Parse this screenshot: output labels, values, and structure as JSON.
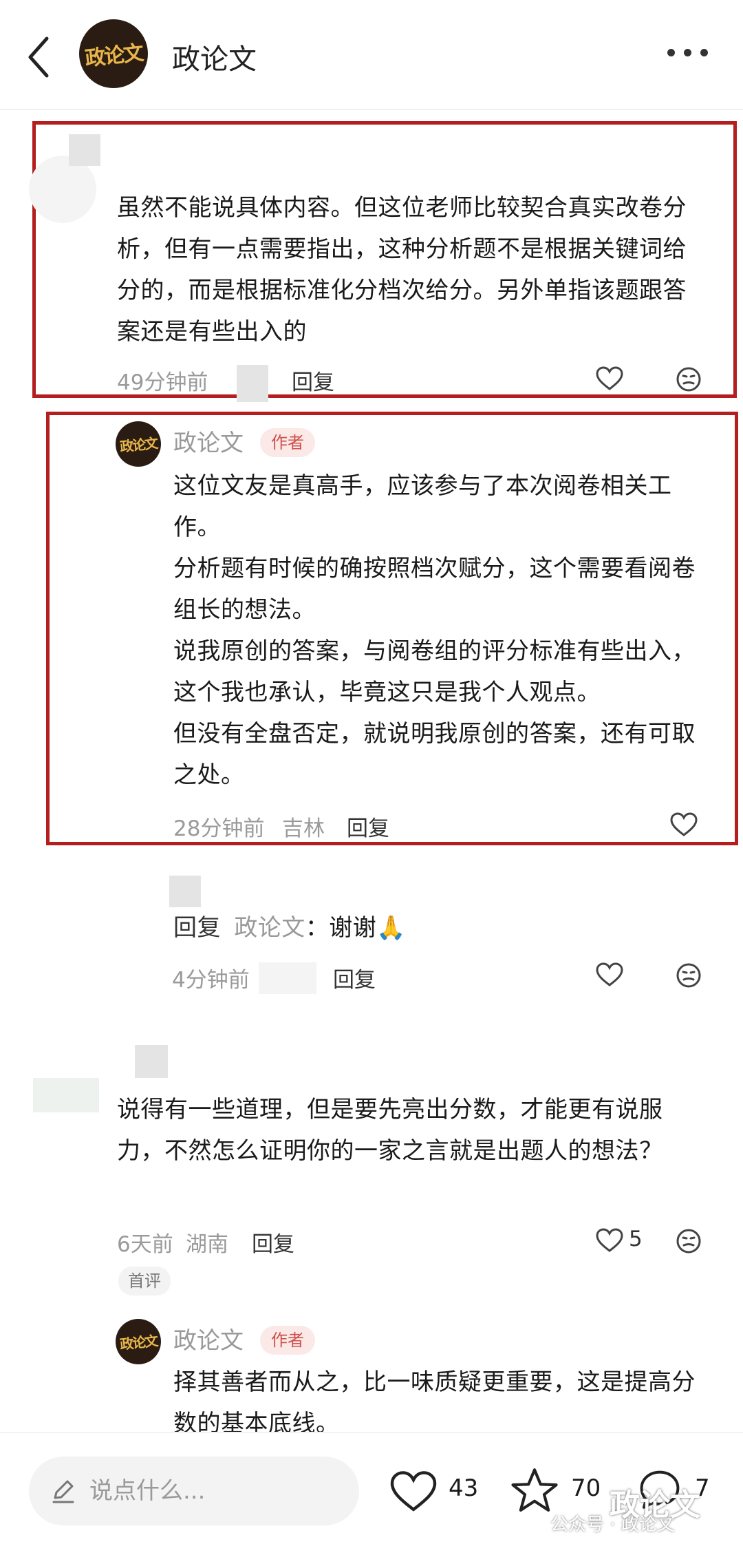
{
  "header": {
    "title": "政论文",
    "logo_text": "政论文"
  },
  "comments": [
    {
      "text": "虽然不能说具体内容。但这位老师比较契合真实改卷分析，但有一点需要指出，这种分析题不是根据关键词给分的，而是根据标准化分档次给分。另外单指该题跟答案还是有些出入的",
      "time": "49分钟前",
      "reply_label": "回复",
      "highlighted": true
    },
    {
      "author": "政论文",
      "badge": "作者",
      "lines": [
        "这位文友是真高手，应该参与了本次阅卷相关工作。",
        "分析题有时候的确按照档次赋分，这个需要看阅卷组长的想法。",
        "说我原创的答案，与阅卷组的评分标准有些出入，这个我也承认，毕竟这只是我个人观点。",
        "但没有全盘否定，就说明我原创的答案，还有可取之处。"
      ],
      "time": "28分钟前",
      "location": "吉林",
      "reply_label": "回复",
      "highlighted": true
    },
    {
      "reply_prefix": "回复",
      "reply_to": "政论文",
      "text": "：谢谢🙏",
      "time": "4分钟前",
      "reply_label": "回复"
    },
    {
      "text": "说得有一些道理，但是要先亮出分数，才能更有说服力，不然怎么证明你的一家之言就是出题人的想法？",
      "time": "6天前",
      "location": "湖南",
      "reply_label": "回复",
      "likes": "5",
      "tag": "首评"
    },
    {
      "author": "政论文",
      "badge": "作者",
      "text": "择其善者而从之，比一味质疑更重要，这是提高分数的基本底线。"
    }
  ],
  "bottom_bar": {
    "input_placeholder": "说点什么...",
    "like_count": "43",
    "star_count": "70",
    "comment_count": "7"
  },
  "watermark": {
    "small": "公众号 · 政论文",
    "big": "政论文"
  },
  "colors": {
    "highlight_border": "#b41e1e",
    "author_badge": "#d0504a",
    "logo_bg": "#2a1c12",
    "logo_text": "#e8b64a"
  },
  "icons": [
    "back-arrow-icon",
    "more-dots-icon",
    "heart-icon",
    "meh-face-icon",
    "pencil-icon",
    "star-icon",
    "comment-bubble-icon"
  ]
}
